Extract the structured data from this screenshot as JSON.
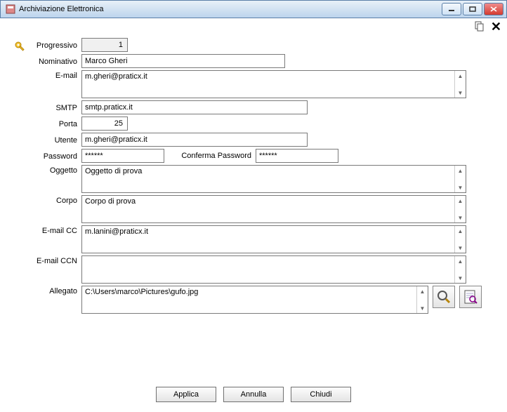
{
  "window": {
    "title": "Archiviazione Elettronica"
  },
  "labels": {
    "progressivo": "Progressivo",
    "nominativo": "Nominativo",
    "email": "E-mail",
    "smtp": "SMTP",
    "porta": "Porta",
    "utente": "Utente",
    "password": "Password",
    "conferma_password": "Conferma Password",
    "oggetto": "Oggetto",
    "corpo": "Corpo",
    "email_cc": "E-mail CC",
    "email_ccn": "E-mail CCN",
    "allegato": "Allegato"
  },
  "values": {
    "progressivo": "1",
    "nominativo": "Marco Gheri",
    "email": "m.gheri@praticx.it",
    "smtp": "smtp.praticx.it",
    "porta": "25",
    "utente": "m.gheri@praticx.it",
    "password": "******",
    "conferma_password": "******",
    "oggetto": "Oggetto di prova",
    "corpo": "Corpo di prova",
    "email_cc": "m.lanini@praticx.it",
    "email_ccn": "",
    "allegato": "C:\\Users\\marco\\Pictures\\gufo.jpg"
  },
  "buttons": {
    "applica": "Applica",
    "annulla": "Annulla",
    "chiudi": "Chiudi"
  }
}
